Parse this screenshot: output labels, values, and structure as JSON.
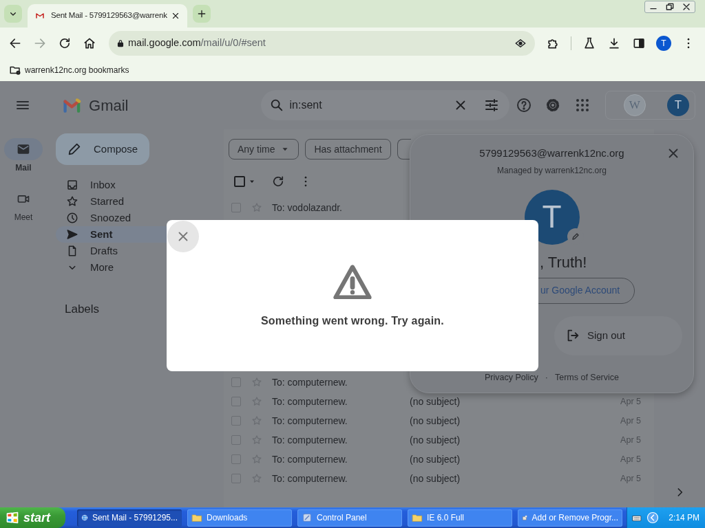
{
  "browser": {
    "tabs": [
      {
        "title": "Sent Mail - 5799129563@warrenk",
        "selected": true
      }
    ],
    "nav_buttons": [
      {
        "kind": "back",
        "disabled": false
      },
      {
        "kind": "forward",
        "disabled": true
      },
      {
        "kind": "reload",
        "disabled": false
      },
      {
        "kind": "home",
        "disabled": false
      }
    ],
    "address": {
      "domain": "mail.google.com",
      "path": "/mail/u/0/#sent"
    },
    "profile_initial": "T",
    "bookmarks": [
      {
        "label": "warrenk12nc.org bookmarks"
      }
    ]
  },
  "gmail": {
    "logo_text": "Gmail",
    "search": {
      "value": "in:sent"
    },
    "org_badge": "W",
    "account_initial": "T",
    "rail": [
      {
        "label": "Mail",
        "kind": "mail",
        "selected": true
      },
      {
        "label": "Meet",
        "kind": "meet",
        "selected": false
      }
    ],
    "compose": "Compose",
    "folders": [
      {
        "label": "Inbox",
        "kind": "inbox",
        "selected": false
      },
      {
        "label": "Starred",
        "kind": "star",
        "selected": false
      },
      {
        "label": "Snoozed",
        "kind": "clock",
        "selected": false
      },
      {
        "label": "Sent",
        "kind": "send",
        "selected": true
      },
      {
        "label": "Drafts",
        "kind": "draft",
        "selected": false
      },
      {
        "label": "More",
        "kind": "more",
        "selected": false
      }
    ],
    "labels_heading": "Labels",
    "filters": [
      {
        "kind": "dropdown",
        "label": "Any time"
      },
      {
        "kind": "chip",
        "label": "Has attachment"
      },
      {
        "kind": "cut"
      }
    ],
    "rows_above": [
      {
        "to": "To: vodolazandr.",
        "checked": false
      }
    ],
    "rows_below": [
      {
        "to": "To: computernew.",
        "checked": false
      },
      {
        "to": "To: computernew.",
        "subject": "(no subject)",
        "date": "Apr 5",
        "checked": false
      },
      {
        "to": "To: computernew.",
        "subject": "(no subject)",
        "date": "Apr 5",
        "checked": false
      },
      {
        "to": "To: computernew.",
        "subject": "(no subject)",
        "date": "Apr 5",
        "checked": false
      },
      {
        "to": "To: computernew.",
        "subject": "(no subject)",
        "date": "Apr 5",
        "checked": false
      },
      {
        "to": "To: computernew.",
        "subject": "(no subject)",
        "date": "Apr 5",
        "checked": false
      }
    ]
  },
  "account_popup": {
    "email": "5799129563@warrenk12nc.org",
    "managed": "Managed by warrenk12nc.org",
    "initial": "T",
    "greeting": ", Truth!",
    "manage_button": "ur Google Account",
    "sign_out": "Sign out",
    "links": [
      "Privacy Policy",
      "Terms of Service"
    ],
    "separator": "·"
  },
  "error_dialog": {
    "message": "Something went wrong. Try again."
  },
  "taskbar": {
    "start": "start",
    "tasks": [
      {
        "label": "Sent Mail - 57991295...",
        "kind": "ie",
        "selected": true
      },
      {
        "label": "Downloads",
        "kind": "folder",
        "selected": false
      },
      {
        "label": "Control Panel",
        "kind": "control-panel",
        "selected": false
      },
      {
        "label": "IE 6.0 Full",
        "kind": "folder",
        "selected": false
      },
      {
        "label": "Add or Remove Progr...",
        "kind": "add-remove",
        "selected": false
      }
    ],
    "clock": "2:14 PM"
  }
}
